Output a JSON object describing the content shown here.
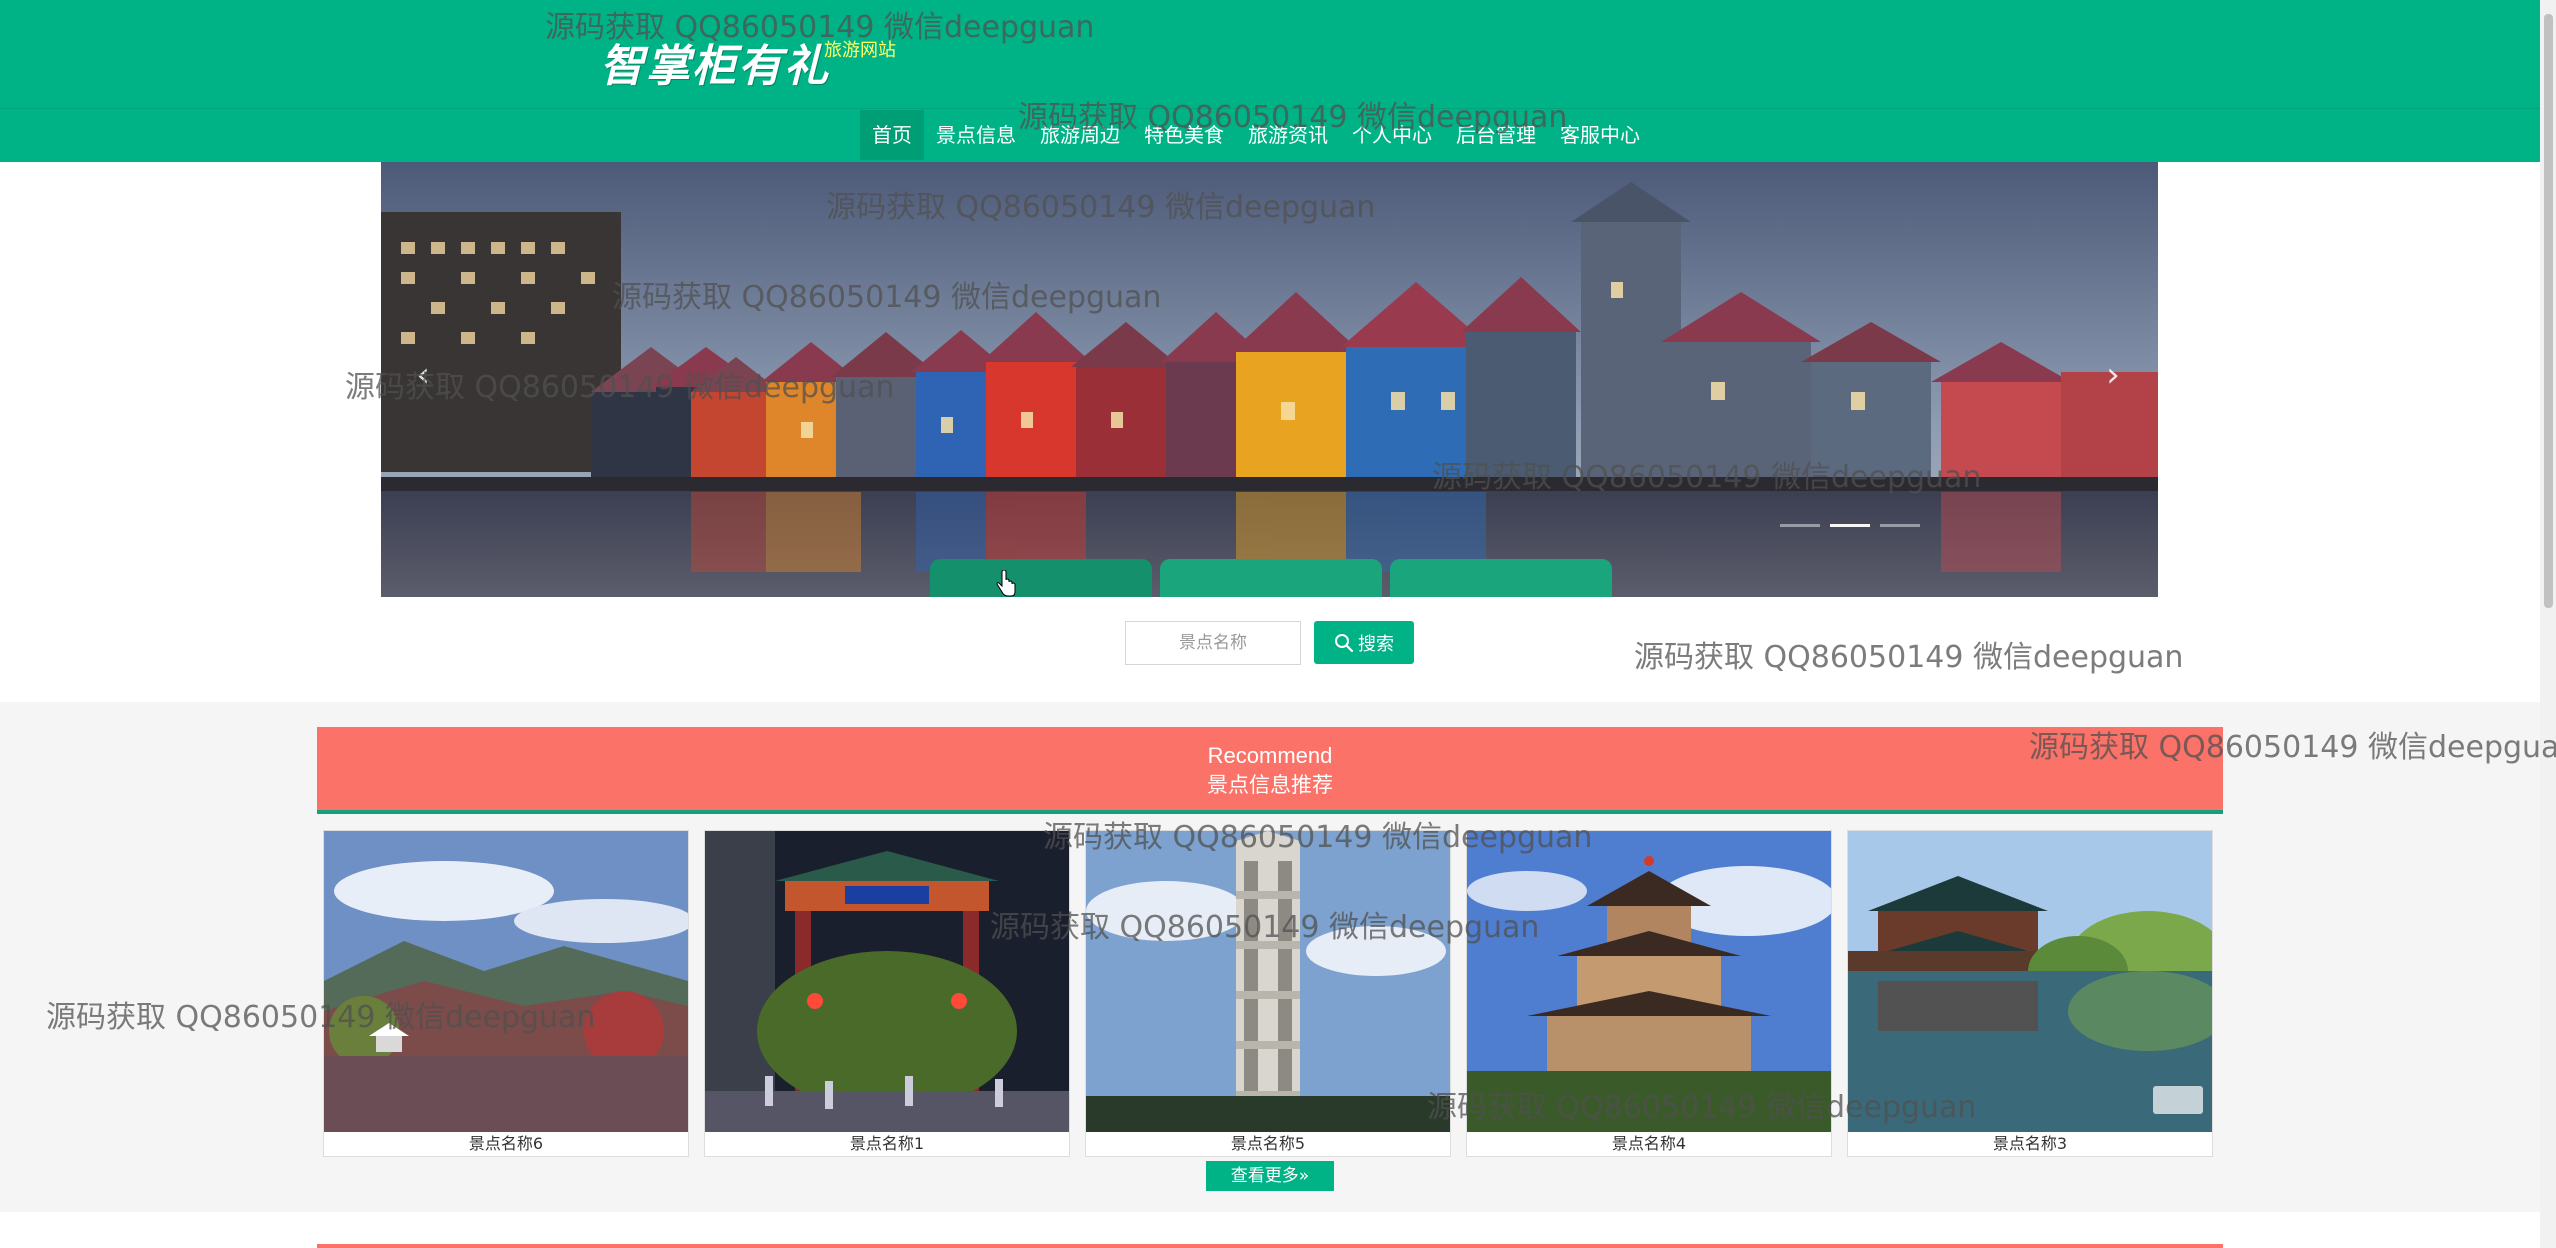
{
  "header": {
    "logo_text": "智掌柜有礼",
    "logo_subtitle": "旅游网站"
  },
  "nav": {
    "items": [
      {
        "label": "首页",
        "active": true
      },
      {
        "label": "景点信息"
      },
      {
        "label": "旅游周边"
      },
      {
        "label": "特色美食"
      },
      {
        "label": "旅游资讯"
      },
      {
        "label": "个人中心"
      },
      {
        "label": "后台管理"
      },
      {
        "label": "客服中心"
      }
    ]
  },
  "carousel": {
    "prev_symbol": "‹",
    "next_symbol": "›",
    "dots": 3,
    "active_dot": 1,
    "tabs": 3,
    "active_tab": 0
  },
  "search": {
    "placeholder": "景点名称",
    "button_label": "搜索"
  },
  "recommend": {
    "title_en": "Recommend",
    "title_cn": "景点信息推荐",
    "items": [
      {
        "name": "景点名称6"
      },
      {
        "name": "景点名称1"
      },
      {
        "name": "景点名称5"
      },
      {
        "name": "景点名称4"
      },
      {
        "name": "景点名称3"
      }
    ],
    "more_label": "查看更多"
  },
  "watermark_text": "源码获取 QQ86050149 微信deepguan",
  "colors": {
    "primary": "#00b386",
    "recommend_bg": "#fa7268",
    "logo_subtitle": "#ffff66"
  }
}
